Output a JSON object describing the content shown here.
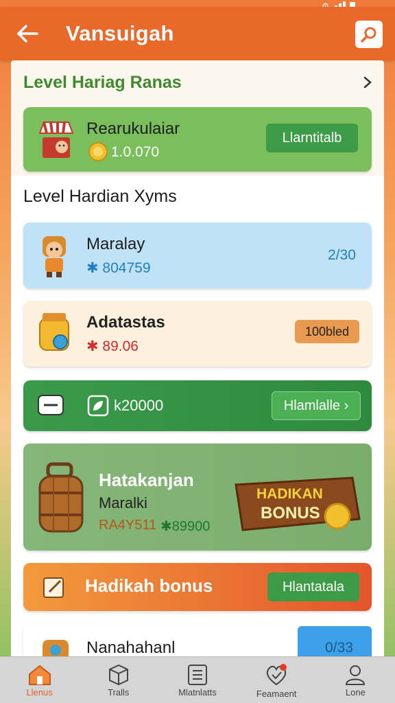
{
  "app_bar": {
    "title": "Vansuigah"
  },
  "section": {
    "title": "Level Hariag Ranas",
    "subtitle": "Level Hardian Xyms"
  },
  "cards": [
    {
      "name": "Rearukulaiar",
      "value": "1.0.070",
      "button": "Llarntitalb"
    },
    {
      "name": "Maralay",
      "value": "✱ 804759",
      "side": "2/30"
    },
    {
      "name": "Adatastas",
      "value": "✱ 89.06",
      "button": "100bled"
    },
    {
      "value": "k20000",
      "button": "Hlamlalle ›"
    },
    {
      "name": "Hatakanjan",
      "sub": "Maralki",
      "value_a": "RA4Y511",
      "value_b": "✱89900",
      "badge_line1": "HADIKAN",
      "badge_line2": "BONUS"
    },
    {
      "name": "Hadikah bonus",
      "button": "Hlantatala"
    },
    {
      "name": "Nanahahanl",
      "side": "0/33"
    }
  ],
  "nav": [
    {
      "label": "Llenus",
      "icon": "home-icon"
    },
    {
      "label": "Tralls",
      "icon": "box-icon"
    },
    {
      "label": "Mlatnlatts",
      "icon": "list-icon"
    },
    {
      "label": "Feamaent",
      "icon": "heart-check-icon"
    },
    {
      "label": "Lone",
      "icon": "user-icon"
    }
  ],
  "colors": {
    "accent": "#e9692a",
    "green": "#3f8a2f",
    "button_green": "#3d9a47",
    "button_orange": "#e99a50"
  }
}
